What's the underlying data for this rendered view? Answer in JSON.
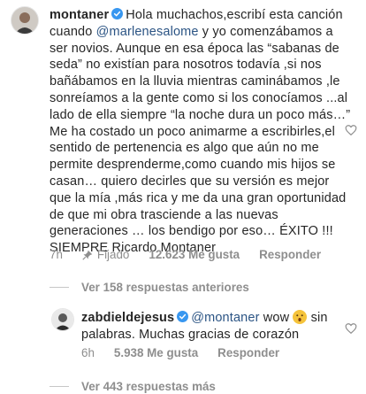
{
  "comment1": {
    "username": "montaner",
    "text_parts": {
      "p1": "Hola muchachos,escribí esta canción cuando ",
      "mention": "@marlenesalome",
      "p2": " y yo comenzábamos a ser novios. Aunque en esa época las “sabanas de seda” no existían para nosotros todavía ,si nos bañábamos en la lluvia mientras caminábamos ,le sonreíamos a la gente como si los conocíamos ...al lado de ella siempre “la noche dura un poco más…” Me ha costado un poco animarme a escribirles,el sentido de pertenencia es algo que aún no me permite desprenderme,como cuando mis hijos se casan… quiero decirles que su versión es mejor que la mía ,más rica y me da una gran oportunidad de que mi obra trasciende a las nuevas generaciones … los bendigo por eso… ÉXITO !!! SIEMPRE Ricardo Montaner"
    },
    "time": "7h",
    "pinned_label": "Fijado",
    "likes": "12.623 Me gusta",
    "reply_label": "Responder"
  },
  "view_previous": "Ver 158 respuestas anteriores",
  "comment2": {
    "username": "zabdieldejesus",
    "mention": "@montaner",
    "text_a": " wow ",
    "text_b": " sin palabras. Muchas gracias de corazón",
    "time": "6h",
    "likes": "5.938 Me gusta",
    "reply_label": "Responder"
  },
  "view_more": "Ver 443 respuestas más",
  "colors": {
    "mention": "#2b5484",
    "verified": "#3897f0",
    "muted": "#8e8e8e"
  }
}
